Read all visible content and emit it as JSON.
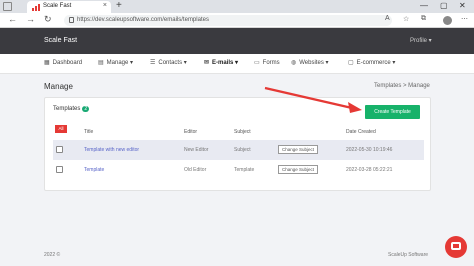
{
  "browser": {
    "tab_title": "Scale Fast",
    "tab_close": "×",
    "new_tab": "+",
    "url": "https://dev.scaleupsoftware.com/emails/templates",
    "minimize": "—",
    "maximize": "▢",
    "close": "✕"
  },
  "header": {
    "brand": "Scale Fast",
    "profile": "Profile ▾"
  },
  "nav": {
    "items": [
      {
        "icon": "▦",
        "label": "Dashboard"
      },
      {
        "icon": "▤",
        "label": "Manage ▾"
      },
      {
        "icon": "☰",
        "label": "Contacts ▾"
      },
      {
        "icon": "✉",
        "label": "E-mails ▾"
      },
      {
        "icon": "▭",
        "label": "Forms"
      },
      {
        "icon": "◍",
        "label": "Websites ▾"
      },
      {
        "icon": "▢",
        "label": "E-commerce ▾"
      }
    ]
  },
  "page": {
    "title": "Manage",
    "breadcrumb": "Templates  >  Manage"
  },
  "card": {
    "title": "Templates",
    "count": "2",
    "create_label": "Create Template",
    "select_all": "All",
    "columns": {
      "title": "Title",
      "editor": "Editor",
      "subject": "Subject",
      "date": "Date Created"
    },
    "rows": [
      {
        "title": "Template with new editor",
        "editor": "New Editor",
        "subject": "Subject",
        "action": "Change Subject",
        "date": "2022-05-30 10:19:46"
      },
      {
        "title": "Template",
        "editor": "Old Editor",
        "subject": "Template",
        "action": "Change Subject",
        "date": "2022-03-28 05:22:21"
      }
    ]
  },
  "footer": {
    "left": "2022 ©",
    "right": "ScaleUp Software"
  },
  "colors": {
    "accent_green": "#17b26a",
    "annotation_red": "#e53935",
    "header_dark": "#3a3a3f"
  }
}
